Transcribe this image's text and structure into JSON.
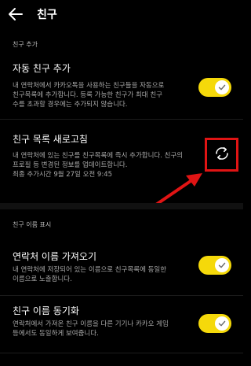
{
  "header": {
    "title": "친구",
    "back_icon": "back-arrow-icon"
  },
  "sections": {
    "add": {
      "label": "친구 추가"
    },
    "display": {
      "label": "친구 이름 표시"
    }
  },
  "items": {
    "auto_add": {
      "title": "자동 친구 추가",
      "desc_lines": [
        "내 연락처에서 카카오톡을 사용하는 친구들을 자동으로",
        "친구목록에 추가합니다. 등록 가능한 친구가 최대 친구",
        "수를 초과할 경우에는 추가되지 않습니다."
      ],
      "toggle_on": true
    },
    "refresh": {
      "title": "친구 목록 새로고침",
      "desc_lines": [
        "내 연락처에 있는 친구를 친구목록에 즉시 추가합니다. 친구의",
        "프로필 등 변경된 정보를 업데이트합니다.",
        "최종 추가시간 9월 27일 오전 9:45"
      ],
      "refresh_icon": "refresh-icon"
    },
    "import_names": {
      "title": "연락처 이름 가져오기",
      "desc_lines": [
        "내 연락처에 저장되어 있는 이름으로 친구목록에 동일한",
        "이름으로 노출합니다."
      ],
      "toggle_on": true
    },
    "sync_names": {
      "title": "친구 이름 동기화",
      "desc_lines": [
        "연락처에서 가져온 친구 이름을 다른 기기나 카카오 게임",
        "등에서도 동일하게 보여줍니다."
      ],
      "toggle_on": true
    }
  },
  "colors": {
    "accent": "#f5d90a",
    "annotation": "#e01414"
  }
}
